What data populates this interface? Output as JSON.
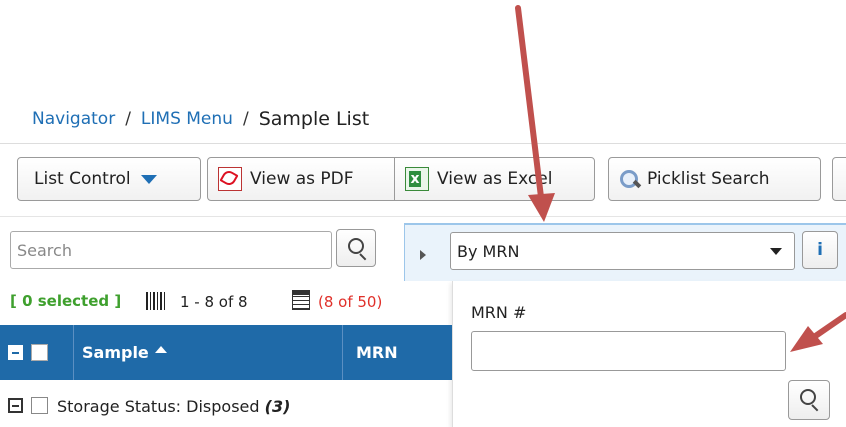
{
  "breadcrumb": {
    "items": [
      "Navigator",
      "LIMS Menu"
    ],
    "separator": "/",
    "current": "Sample List"
  },
  "toolbar": {
    "list_control": "List Control",
    "view_pdf": "View as PDF",
    "view_excel": "View as Excel",
    "picklist_search": "Picklist Search"
  },
  "search": {
    "placeholder": "Search"
  },
  "filter": {
    "selected": "By MRN",
    "info_label": "i",
    "mrn_label": "MRN #",
    "mrn_value": ""
  },
  "selection": {
    "selected_text": "[ 0 selected ]",
    "range_text": "1 - 8 of 8",
    "count_text": "(8 of 50)"
  },
  "table": {
    "columns": [
      "Sample",
      "MRN"
    ],
    "group_row": {
      "label": "Storage Status: Disposed",
      "count": "(3)"
    }
  },
  "colors": {
    "accent": "#1f6aa8",
    "link": "#1f6fb5",
    "selected_green": "#3fa02e",
    "count_red": "#e0302a",
    "annotation_arrow": "#c0504d"
  }
}
